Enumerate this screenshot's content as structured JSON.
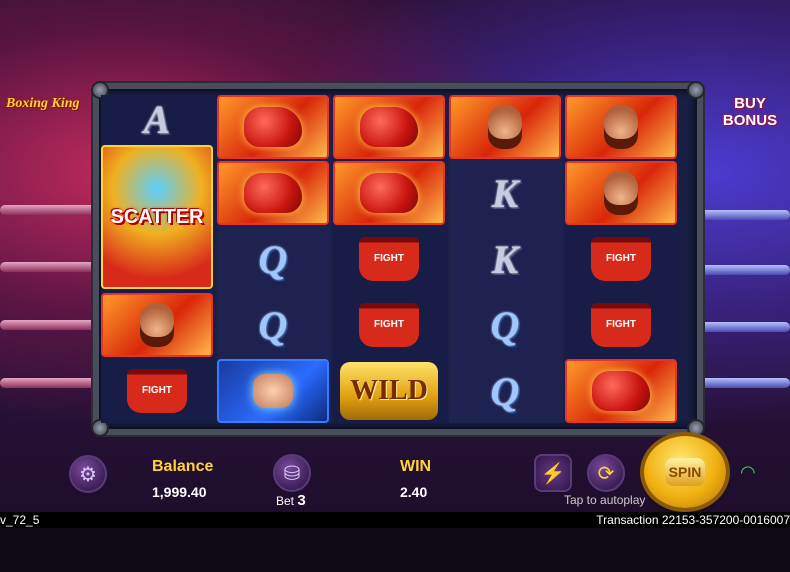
{
  "logo_text": "Boxing King",
  "buy_bonus": {
    "line1": "BUY",
    "line2": "BONUS"
  },
  "reels": [
    [
      {
        "type": "letter",
        "text": "A"
      },
      {
        "type": "scatter",
        "text": "SCATTER"
      },
      {
        "type": "boxer",
        "text": ""
      },
      {
        "type": "shorts",
        "text": "FIGHT"
      }
    ],
    [
      {
        "type": "glove",
        "text": ""
      },
      {
        "type": "glove",
        "text": ""
      },
      {
        "type": "letter",
        "text": "Q"
      },
      {
        "type": "letter",
        "text": "Q"
      },
      {
        "type": "fist",
        "text": ""
      }
    ],
    [
      {
        "type": "glove",
        "text": ""
      },
      {
        "type": "glove",
        "text": ""
      },
      {
        "type": "shorts",
        "text": "FIGHT"
      },
      {
        "type": "shorts",
        "text": "FIGHT"
      },
      {
        "type": "wild",
        "text": "WILD"
      }
    ],
    [
      {
        "type": "boxer",
        "text": ""
      },
      {
        "type": "letter",
        "text": "K"
      },
      {
        "type": "letter",
        "text": "K"
      },
      {
        "type": "letter",
        "text": "Q"
      },
      {
        "type": "letter",
        "text": "Q"
      }
    ],
    [
      {
        "type": "boxer",
        "text": ""
      },
      {
        "type": "boxer",
        "text": ""
      },
      {
        "type": "shorts",
        "text": "FIGHT"
      },
      {
        "type": "shorts",
        "text": "FIGHT"
      },
      {
        "type": "glove",
        "text": ""
      }
    ]
  ],
  "balance": {
    "label": "Balance",
    "value": "1,999.40"
  },
  "bet": {
    "label": "Bet",
    "value": "3"
  },
  "win": {
    "label": "WIN",
    "value": "2.40"
  },
  "autoplay_hint": "Tap to autoplay",
  "version": "v_72_5",
  "transaction": "Transaction 22153-357200-0016007",
  "spin_label": "SPIN",
  "colors": {
    "accent_yellow": "#ffd23a",
    "frame_red": "#e8322a",
    "frame_blue": "#3a7cff"
  },
  "icons": {
    "settings": "gear-icon",
    "bet": "coin-stack-icon",
    "turbo": "lightning-icon",
    "autoplay": "autoplay-icon",
    "wifi": "wifi-icon"
  }
}
